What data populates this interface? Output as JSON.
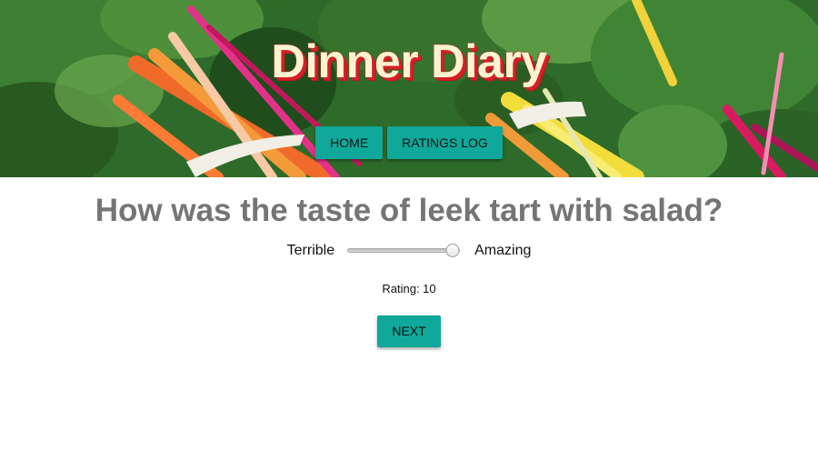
{
  "header": {
    "title": "Dinner Diary",
    "background_image": "rainbow-chard-vegetables"
  },
  "nav": {
    "items": [
      {
        "label": "HOME"
      },
      {
        "label": "RATINGS LOG"
      }
    ]
  },
  "question": {
    "prefix": "How was the ",
    "emphasis": "taste",
    "suffix": " of leek tart with salad?"
  },
  "slider": {
    "min_label": "Terrible",
    "max_label": "Amazing",
    "value": 10,
    "min": 0,
    "max": 10
  },
  "rating": {
    "text": "Rating: 10"
  },
  "next_button": {
    "label": "NEXT"
  },
  "colors": {
    "accent": "#0fa89a",
    "title_fill": "#fdf3d0",
    "title_shadow": "#d61f26",
    "question_text": "#757575"
  }
}
